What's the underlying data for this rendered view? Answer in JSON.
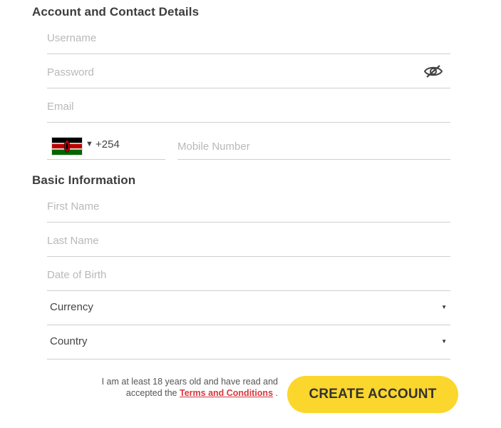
{
  "account_section": {
    "title": "Account and Contact Details",
    "username_placeholder": "Username",
    "password_placeholder": "Password",
    "email_placeholder": "Email",
    "password_toggle_icon": "eye-slash-icon",
    "phone": {
      "flag_icon": "kenya-flag-icon",
      "dial_code": "+254",
      "mobile_placeholder": "Mobile Number"
    }
  },
  "basic_section": {
    "title": "Basic Information",
    "first_name_placeholder": "First Name",
    "last_name_placeholder": "Last Name",
    "dob_placeholder": "Date of Birth",
    "currency_label": "Currency",
    "country_label": "Country"
  },
  "consent": {
    "text": "I am at least 18 years old and have read and accepted the",
    "terms_link": "Terms and Conditions",
    "suffix": "."
  },
  "actions": {
    "create_account_label": "CREATE ACCOUNT"
  },
  "colors": {
    "accent_button": "#fbd62c",
    "link": "#d9363e",
    "underline": "#cfcfcf"
  }
}
